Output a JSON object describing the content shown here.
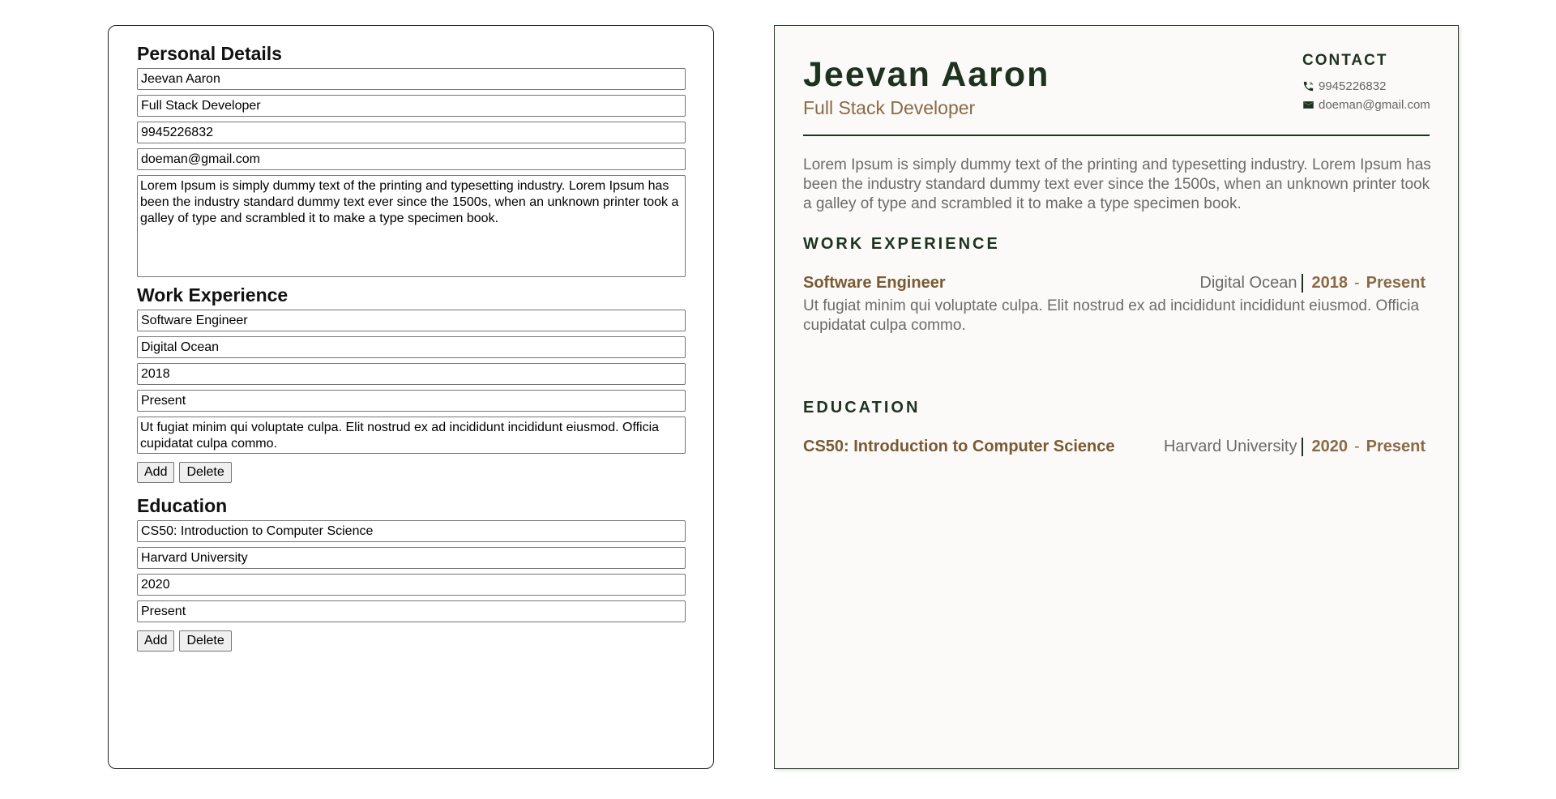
{
  "form": {
    "personal": {
      "heading": "Personal Details",
      "name": "Jeevan Aaron",
      "title": "Full Stack Developer",
      "phone": "9945226832",
      "email": "doeman@gmail.com",
      "summary": "Lorem Ipsum is simply dummy text of the printing and typesetting industry. Lorem Ipsum has been the industry standard dummy text ever since the 1500s, when an unknown printer took a galley of type and scrambled it to make a type specimen book."
    },
    "work": {
      "heading": "Work Experience",
      "role": "Software Engineer",
      "company": "Digital Ocean",
      "start": "2018",
      "end": "Present",
      "description": "Ut fugiat minim qui voluptate culpa. Elit nostrud ex ad incididunt incididunt eiusmod. Officia cupidatat culpa commo.",
      "add_label": "Add",
      "delete_label": "Delete"
    },
    "education": {
      "heading": "Education",
      "course": "CS50: Introduction to Computer Science",
      "institution": "Harvard University",
      "start": "2020",
      "end": "Present",
      "add_label": "Add",
      "delete_label": "Delete"
    }
  },
  "resume": {
    "name": "Jeevan Aaron",
    "title": "Full Stack Developer",
    "contact_heading": "CONTACT",
    "phone": "9945226832",
    "email": "doeman@gmail.com",
    "summary": "Lorem Ipsum is simply dummy text of the printing and typesetting industry. Lorem Ipsum has been the industry standard dummy text ever since the 1500s, when an unknown printer took a galley of type and scrambled it to make a type specimen book.",
    "work_heading": "WORK EXPERIENCE",
    "work": {
      "role": "Software Engineer",
      "company": "Digital Ocean",
      "start": "2018",
      "separator": "-",
      "end": "Present",
      "description": "Ut fugiat minim qui voluptate culpa. Elit nostrud ex ad incididunt incididunt eiusmod. Officia cupidatat culpa commo."
    },
    "education_heading": "EDUCATION",
    "education": {
      "course": "CS50: Introduction to Computer Science",
      "institution": "Harvard University",
      "start": "2020",
      "separator": "-",
      "end": "Present"
    },
    "icons": {
      "phone": "phone-icon",
      "email": "mail-icon"
    },
    "colors": {
      "accent_green": "#1d3320",
      "accent_brown": "#8a6a45",
      "paper": "#fbfaf8"
    }
  }
}
